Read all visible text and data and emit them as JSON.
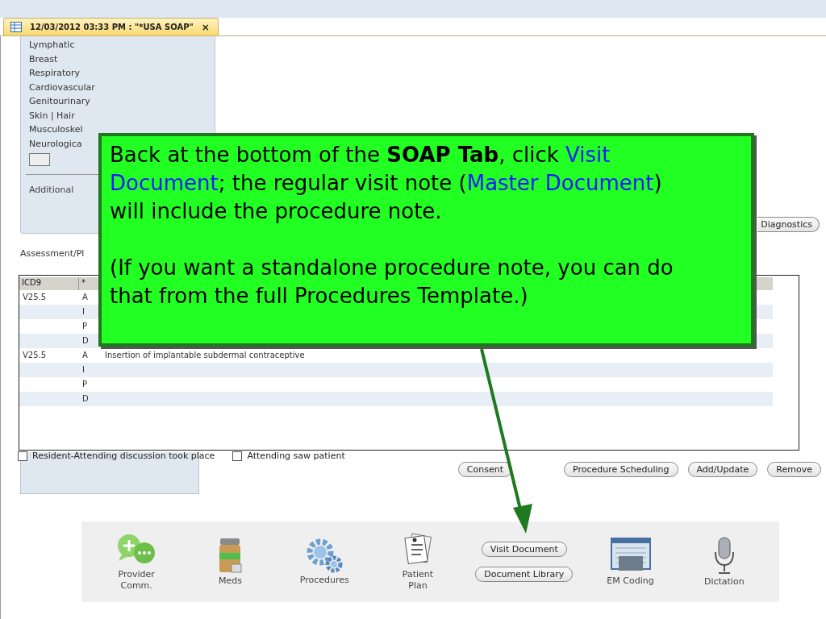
{
  "tab": {
    "title": "12/03/2012 03:33 PM : \"*USA SOAP\"",
    "close": "×"
  },
  "systems": [
    "Lymphatic",
    "Breast",
    "Respiratory",
    "Cardiovascular",
    "Genitourinary",
    "Skin | Hair",
    "Musculoskel",
    "Neurologica"
  ],
  "additional": "Additional",
  "office_button": "Diagnostics",
  "assessment_label": "Assessment/Pl",
  "table": {
    "columns": [
      "ICD9",
      "*"
    ],
    "rows": [
      {
        "icd9": "V25.5",
        "code": "A"
      },
      {
        "code": "I"
      },
      {
        "code": "P"
      },
      {
        "code": "D"
      },
      {
        "icd9": "V25.5",
        "code": "A",
        "description": "Insertion of implantable subdermal contraceptive"
      },
      {
        "code": "I"
      },
      {
        "code": "P"
      },
      {
        "code": "D"
      }
    ]
  },
  "checkboxes": [
    {
      "label": "Resident-Attending discussion took place",
      "checked": false
    },
    {
      "label": "Attending saw patient",
      "checked": false
    }
  ],
  "action_buttons": [
    "Consent",
    "Procedure Scheduling",
    "Add/Update",
    "Remove"
  ],
  "toolbar": [
    {
      "kind": "tool",
      "label": "Provider Comm."
    },
    {
      "kind": "tool",
      "label": "Meds"
    },
    {
      "kind": "tool",
      "label": "Procedures"
    },
    {
      "kind": "tool",
      "label": "Patient Plan"
    },
    {
      "kind": "buttons",
      "buttons": [
        "Visit Document",
        "Document Library"
      ]
    },
    {
      "kind": "tool",
      "label": "EM Coding"
    },
    {
      "kind": "tool",
      "label": "Dictation"
    }
  ],
  "callout": {
    "paragraphs": [
      [
        {
          "text": "Back at the bottom of the ",
          "kind": "plain"
        },
        {
          "text": "SOAP Tab",
          "kind": "bold"
        },
        {
          "text": ", click ",
          "kind": "plain"
        },
        {
          "text": "Visit Document",
          "kind": "link"
        },
        {
          "text": "; the regular visit note (",
          "kind": "plain"
        },
        {
          "text": "Master Document",
          "kind": "link"
        },
        {
          "text": ") will include the procedure note.",
          "kind": "plain"
        }
      ],
      [
        {
          "text": "(If you want a standalone procedure note, you can do that from the full Procedures Template.)",
          "kind": "plain"
        }
      ]
    ]
  }
}
